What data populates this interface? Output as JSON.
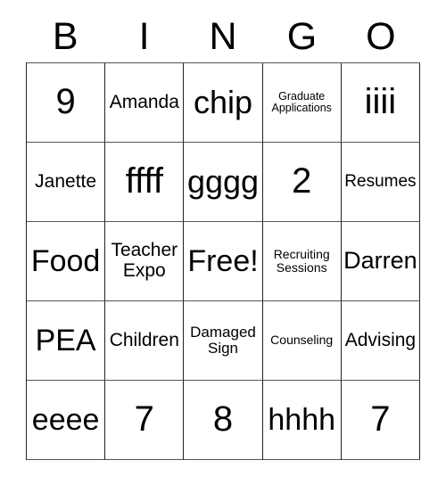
{
  "card": {
    "header": {
      "letters": [
        "B",
        "I",
        "N",
        "G",
        "O"
      ]
    },
    "rows": [
      [
        {
          "text": "9",
          "size": "fs-xxl"
        },
        {
          "text": "Amanda",
          "size": "fs-s"
        },
        {
          "text": "chip",
          "size": "fs-xl"
        },
        {
          "text": "Graduate\nApplications",
          "size": "fs-micro"
        },
        {
          "text": "iiii",
          "size": "fs-xxl"
        }
      ],
      [
        {
          "text": "Janette",
          "size": "fs-s"
        },
        {
          "text": "ffff",
          "size": "fs-xxl"
        },
        {
          "text": "gggg",
          "size": "fs-xl"
        },
        {
          "text": "2",
          "size": "fs-xxl"
        },
        {
          "text": "Resumes",
          "size": "fs-xs"
        }
      ],
      [
        {
          "text": "Food",
          "size": "fs-l"
        },
        {
          "text": "Teacher\nExpo",
          "size": "fs-s"
        },
        {
          "text": "Free!",
          "size": "fs-l"
        },
        {
          "text": "Recruiting\nSessions",
          "size": "fs-tiny"
        },
        {
          "text": "Darren",
          "size": "fs-m"
        }
      ],
      [
        {
          "text": "PEA",
          "size": "fs-l"
        },
        {
          "text": "Children",
          "size": "fs-s"
        },
        {
          "text": "Damaged\nSign",
          "size": "fs-xxs"
        },
        {
          "text": "Counseling",
          "size": "fs-tiny"
        },
        {
          "text": "Advising",
          "size": "fs-s"
        }
      ],
      [
        {
          "text": "eeee",
          "size": "fs-l"
        },
        {
          "text": "7",
          "size": "fs-xxl"
        },
        {
          "text": "8",
          "size": "fs-xxl"
        },
        {
          "text": "hhhh",
          "size": "fs-l"
        },
        {
          "text": "7",
          "size": "fs-xxl"
        }
      ]
    ]
  }
}
